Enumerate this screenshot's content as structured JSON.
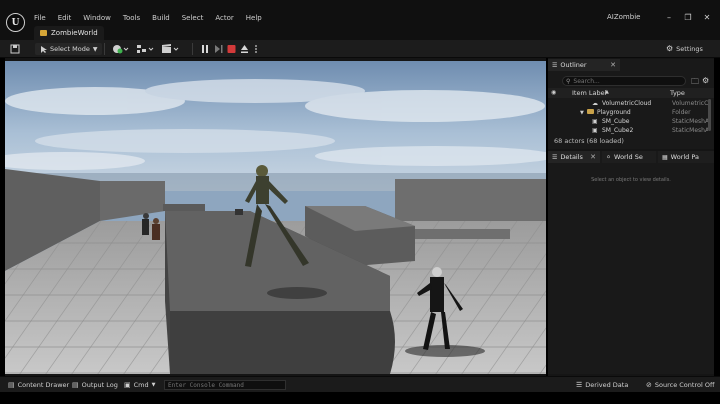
{
  "menu": {
    "items": [
      "File",
      "Edit",
      "Window",
      "Tools",
      "Build",
      "Select",
      "Actor",
      "Help"
    ]
  },
  "window": {
    "project_name": "AIZombie",
    "level_tab": "ZombieWorld",
    "minimize_icon": "minimize-icon",
    "maximize_icon": "maximize-icon",
    "close_icon": "close-icon"
  },
  "toolbar": {
    "select_mode_label": "Select Mode",
    "settings_label": "Settings",
    "icons": [
      "save-icon",
      "add-actor-icon",
      "blueprint-icon",
      "cinematics-icon",
      "pause-icon",
      "advance-frame-icon",
      "stop-icon",
      "eject-icon",
      "more-icon",
      "gear-icon"
    ],
    "colors": {
      "stop": "#d33a3a",
      "accent": "#d6a637"
    }
  },
  "outliner": {
    "tab_label": "Outliner",
    "search_placeholder": "Search...",
    "col_item_label": "Item Label",
    "col_type": "Type",
    "rows": [
      {
        "label": "VolumetricCloud",
        "type": "VolumetricC"
      },
      {
        "label": "Playground",
        "type": "Folder"
      },
      {
        "label": "SM_Cube",
        "type": "StaticMeshA"
      },
      {
        "label": "SM_Cube2",
        "type": "StaticMeshA"
      }
    ],
    "actors_count": "68 actors (68 loaded)"
  },
  "details": {
    "tabs": [
      "Details",
      "World Se",
      "World Pa"
    ],
    "hint": "Select an object to view details."
  },
  "statusbar": {
    "content_drawer": "Content Drawer",
    "output_log": "Output Log",
    "cmd": "Cmd",
    "console_placeholder": "Enter Console Command",
    "derived_data": "Derived Data",
    "source_control": "Source Control Off"
  }
}
